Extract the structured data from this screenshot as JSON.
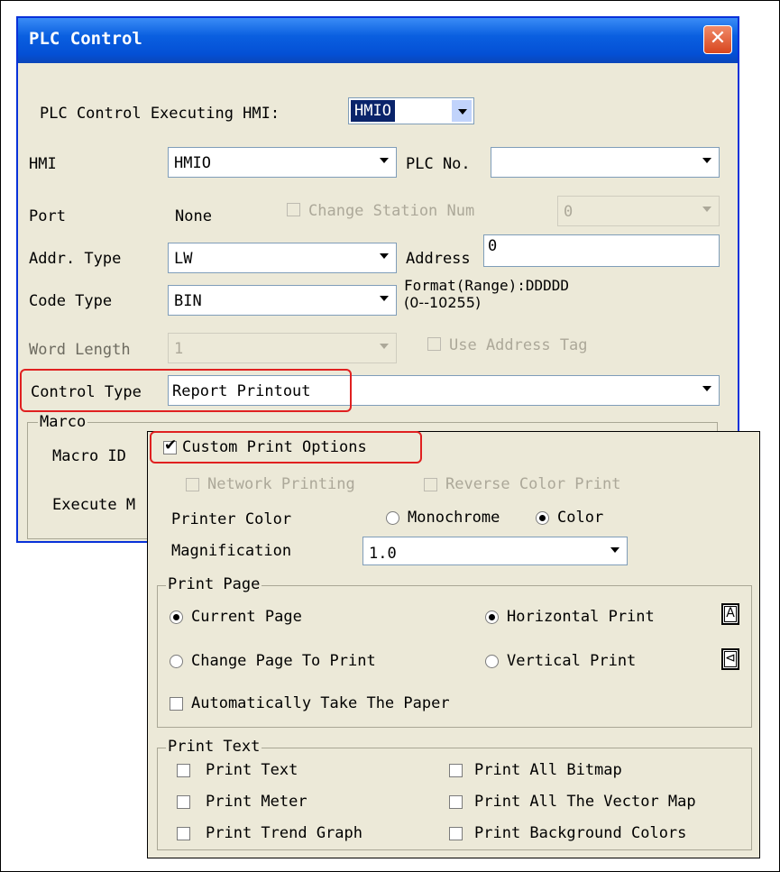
{
  "dialog": {
    "title": "PLC Control",
    "executing_label": "PLC Control Executing HMI:",
    "executing_value": "HMIO",
    "hmi_label": "HMI",
    "hmi_value": "HMIO",
    "plc_no_label": "PLC No.",
    "plc_no_value": "",
    "port_label": "Port",
    "port_value": "None",
    "change_station_label": "Change Station Num",
    "change_station_value": "0",
    "addr_type_label": "Addr. Type",
    "addr_type_value": "LW",
    "address_label": "Address",
    "address_value": "0",
    "code_type_label": "Code Type",
    "code_type_value": "BIN",
    "format_line1": "Format(Range):DDDDD",
    "format_line2": "(0--10255)",
    "word_length_label": "Word Length",
    "word_length_value": "1",
    "use_tag_label": "Use Address Tag",
    "control_type_label": "Control Type",
    "control_type_value": "Report Printout",
    "marco_group": "Marco",
    "macro_id_label": "Macro ID",
    "execute_label": "Execute M"
  },
  "options": {
    "custom_label": "Custom Print Options",
    "custom_checked": true,
    "network_label": "Network Printing",
    "reverse_label": "Reverse Color Print",
    "printer_color_label": "Printer Color",
    "monochrome_label": "Monochrome",
    "color_label": "Color",
    "color_selected": "Color",
    "magnification_label": "Magnification",
    "magnification_value": "1.0",
    "print_page_group": "Print Page",
    "current_page_label": "Current Page",
    "change_page_label": "Change Page To Print",
    "page_selected": "Current Page",
    "horizontal_label": "Horizontal Print",
    "vertical_label": "Vertical Print",
    "orientation_selected": "Horizontal Print",
    "horizontal_icon_glyph": "A",
    "vertical_icon_glyph": "⊲",
    "auto_paper_label": "Automatically Take The Paper",
    "print_text_group": "Print Text",
    "print_text_label": "Print Text",
    "print_meter_label": "Print Meter",
    "print_trend_label": "Print Trend Graph",
    "print_bitmap_label": "Print All Bitmap",
    "print_vector_label": "Print All The Vector Map",
    "print_bg_label": "Print Background Colors"
  },
  "colors": {
    "titlebar": "#0450d5",
    "highlight": "#e02020",
    "dialog_bg": "#ece9d8"
  }
}
